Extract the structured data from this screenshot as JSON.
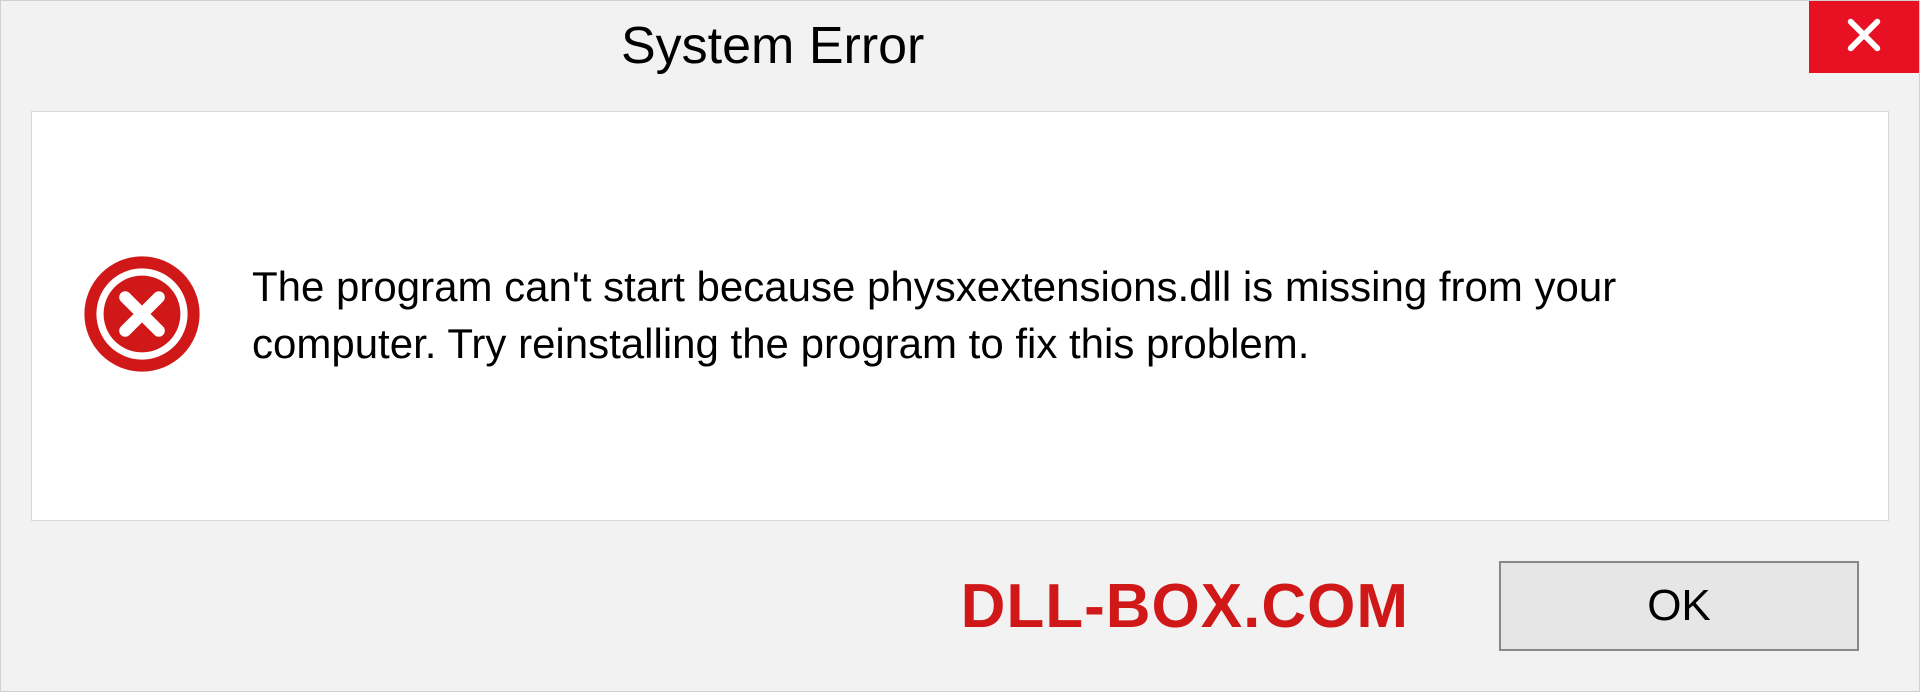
{
  "dialog": {
    "title": "System Error",
    "message": "The program can't start because physxextensions.dll is missing from your computer. Try reinstalling the program to fix this problem.",
    "ok_label": "OK"
  },
  "watermark": "DLL-BOX.COM"
}
